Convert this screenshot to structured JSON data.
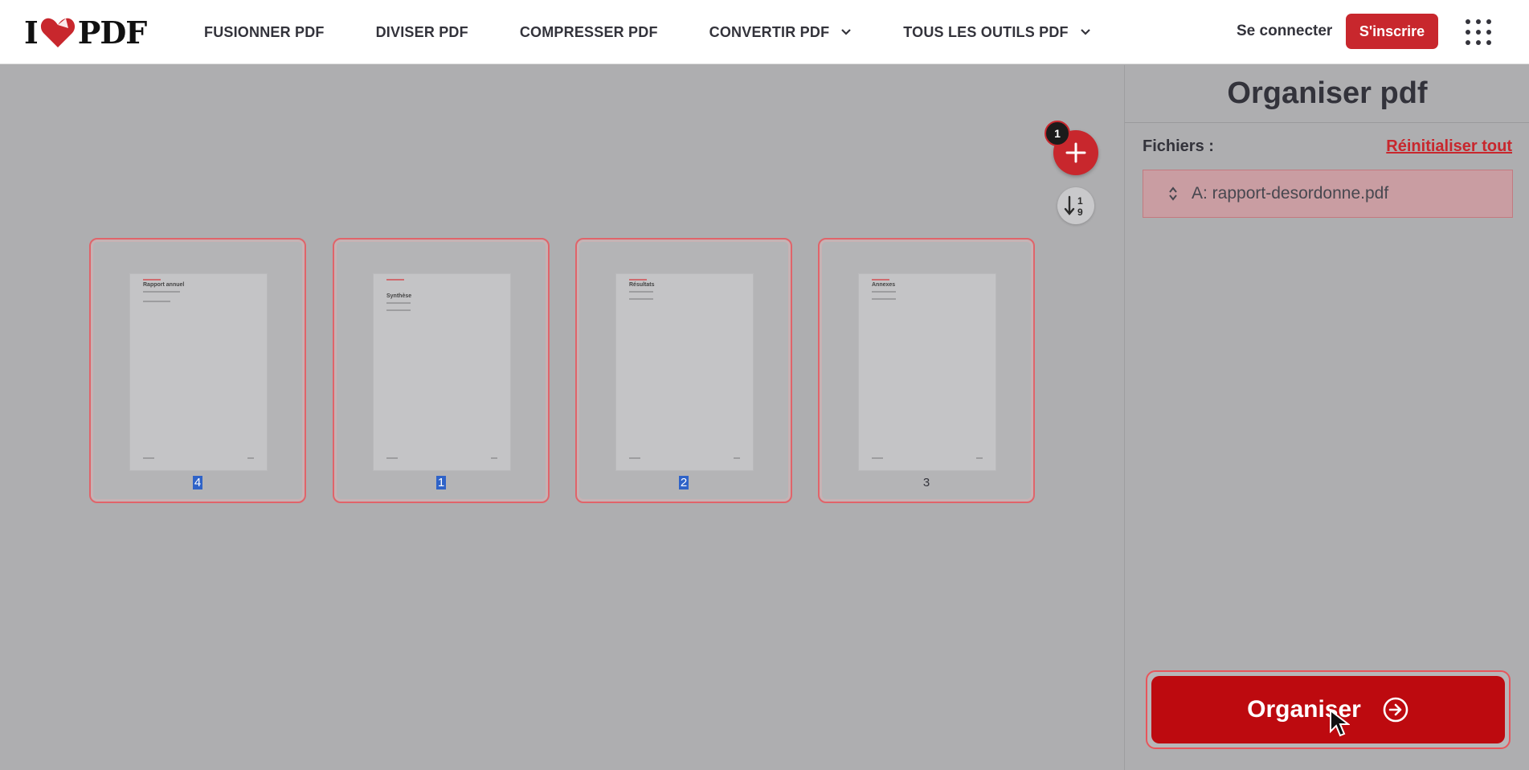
{
  "header": {
    "logo": {
      "left": "I",
      "right": "PDF",
      "brand_color": "#c8272d"
    },
    "nav": [
      {
        "label": "FUSIONNER PDF",
        "has_dropdown": false
      },
      {
        "label": "DIVISER PDF",
        "has_dropdown": false
      },
      {
        "label": "COMPRESSER PDF",
        "has_dropdown": false
      },
      {
        "label": "CONVERTIR PDF",
        "has_dropdown": true
      },
      {
        "label": "TOUS LES OUTILS PDF",
        "has_dropdown": true
      }
    ],
    "login_label": "Se connecter",
    "signup_label": "S'inscrire",
    "apps_icon": "grid-icon"
  },
  "workspace": {
    "add_button_icon": "plus-icon",
    "file_count_badge": "1",
    "sort_button_icon": "sort-numeric-icon",
    "sort_glyph_top": "1",
    "sort_glyph_bottom": "9",
    "pages": [
      {
        "number": "4",
        "selected": true,
        "thumb_title": "Rapport annuel"
      },
      {
        "number": "1",
        "selected": true,
        "thumb_title": "Synthèse"
      },
      {
        "number": "2",
        "selected": true,
        "thumb_title": "Résultats"
      },
      {
        "number": "3",
        "selected": false,
        "thumb_title": "Annexes"
      }
    ]
  },
  "sidebar": {
    "title": "Organiser pdf",
    "files_label": "Fichiers :",
    "reset_label": "Réinitialiser tout",
    "files": [
      {
        "label": "A: rapport-desordonne.pdf"
      }
    ],
    "action_button_label": "Organiser",
    "action_color": "#bd0a0f"
  }
}
